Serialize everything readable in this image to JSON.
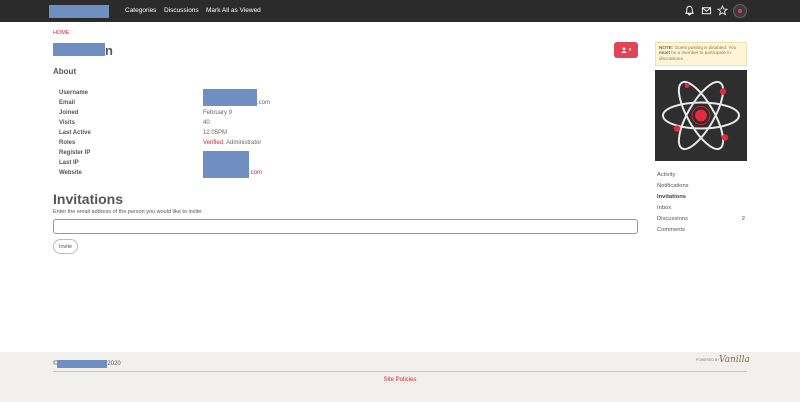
{
  "topbar": {
    "nav": [
      "Categories",
      "Discussions",
      "Mark All as Viewed"
    ],
    "icons": [
      "bell-icon",
      "envelope-icon",
      "star-icon",
      "user-avatar"
    ]
  },
  "breadcrumb": "HOME",
  "profile": {
    "name_visible_suffix": "n",
    "about_heading": "About",
    "fields": [
      {
        "label": "Username",
        "value": ""
      },
      {
        "label": "Email",
        "value": ".com"
      },
      {
        "label": "Joined",
        "value": "February 9"
      },
      {
        "label": "Visits",
        "value": "40"
      },
      {
        "label": "Last Active",
        "value": "12:05PM"
      },
      {
        "label": "Roles",
        "value_link": "Verified",
        "value_rest": ", Administrator"
      },
      {
        "label": "Register IP",
        "value": ""
      },
      {
        "label": "Last IP",
        "value": ""
      },
      {
        "label": "Website",
        "value": ".com"
      }
    ]
  },
  "invitations": {
    "heading": "Invitations",
    "label": "Enter the email address of the person you would like to invite:",
    "input_value": "",
    "button": "Invite"
  },
  "sidebar": {
    "note_bold": "NOTE:",
    "note_text1": " Guest posting is disabled. You ",
    "note_bold2": "must",
    "note_text2": " be a member to participate in discussions.",
    "nav": [
      {
        "label": "Activity",
        "count": ""
      },
      {
        "label": "Notifications",
        "count": ""
      },
      {
        "label": "Invitations",
        "count": "",
        "active": true
      },
      {
        "label": "Inbox",
        "count": ""
      },
      {
        "label": "Discussions",
        "count": "2"
      },
      {
        "label": "Comments",
        "count": ""
      }
    ]
  },
  "footer": {
    "copyright_prefix": "©",
    "copyright_year": "2020",
    "policies": "Site Policies",
    "powered_by": "POWERED BY",
    "brand": "Vanilla"
  },
  "colors": {
    "accent": "#c8283c",
    "button_red": "#e04555",
    "topbar": "#2b2b2b",
    "redaction": "#6f8fc3",
    "footer_bg": "#f1f0ed"
  }
}
